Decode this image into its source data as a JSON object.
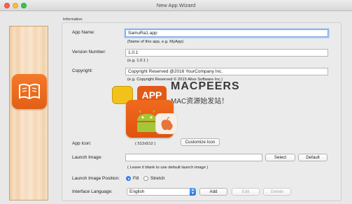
{
  "window": {
    "title": "New App Wizard"
  },
  "group": {
    "label": "Information"
  },
  "app_name": {
    "label": "App Name:",
    "value": "SamuRa1.app",
    "hint": "(Name of this app, e.g. MyApp)"
  },
  "version": {
    "label": "Version Number:",
    "value": "1.0.1",
    "hint": "(e.g. 1.0.1 )"
  },
  "copyright": {
    "label": "Copyright:",
    "value": "Copyright Reserved @2016 YourCompany Inc.",
    "hint": "(e.g. Copyright Reserved © 2015 Alive Software Inc.)"
  },
  "app_icon": {
    "label": "App Icon:",
    "size": "( 512x512 )",
    "customize_label": "Customize Icon"
  },
  "launch_image": {
    "label": "Launch Image:",
    "value": "",
    "select_label": "Select",
    "default_label": "Default",
    "hint": "( Leave it blank to use default launch image )"
  },
  "launch_position": {
    "label": "Launch Image Position:",
    "options": [
      {
        "label": "Fill",
        "selected": true
      },
      {
        "label": "Stretch",
        "selected": false
      }
    ]
  },
  "interface_language": {
    "label": "Interface Language:",
    "selected": "English",
    "add_label": "Add",
    "edit_label": "Edit",
    "delete_label": "Delete"
  },
  "watermark": {
    "title": "MACPEERS",
    "app_text": "APP",
    "subtitle": "MAC资源始发站！"
  },
  "colors": {
    "accent": "#3b86f0",
    "icon_orange": "#e35f16"
  }
}
